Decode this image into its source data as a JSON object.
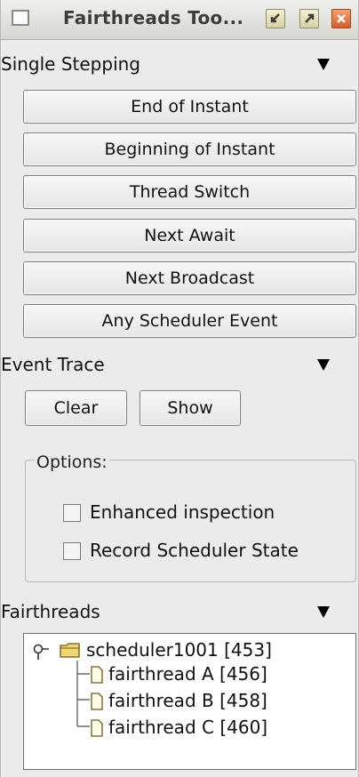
{
  "window": {
    "title": "Fairthreads Too..."
  },
  "single_stepping": {
    "label": "Single Stepping",
    "buttons": [
      "End of Instant",
      "Beginning of Instant",
      "Thread Switch",
      "Next Await",
      "Next Broadcast",
      "Any Scheduler Event"
    ]
  },
  "event_trace": {
    "label": "Event Trace",
    "clear_label": "Clear",
    "show_label": "Show"
  },
  "options": {
    "legend": "Options:",
    "enhanced_inspection": {
      "label": "Enhanced inspection",
      "checked": false
    },
    "record_scheduler_state": {
      "label": "Record Scheduler State",
      "checked": false
    }
  },
  "fairthreads": {
    "label": "Fairthreads",
    "tree": {
      "root": "scheduler1001 [453]",
      "children": [
        "fairthread A [456]",
        "fairthread B [458]",
        "fairthread C [460]"
      ]
    }
  },
  "icons": {
    "collapse": "triangle-down-icon",
    "minimize": "minimize-icon",
    "maximize": "maximize-icon",
    "close": "close-icon",
    "folder": "folder-icon",
    "file": "file-icon",
    "tree_handle": "tree-expand-handle-icon"
  },
  "colors": {
    "close_button": "#d95a2a",
    "folder": "#f0d870"
  }
}
